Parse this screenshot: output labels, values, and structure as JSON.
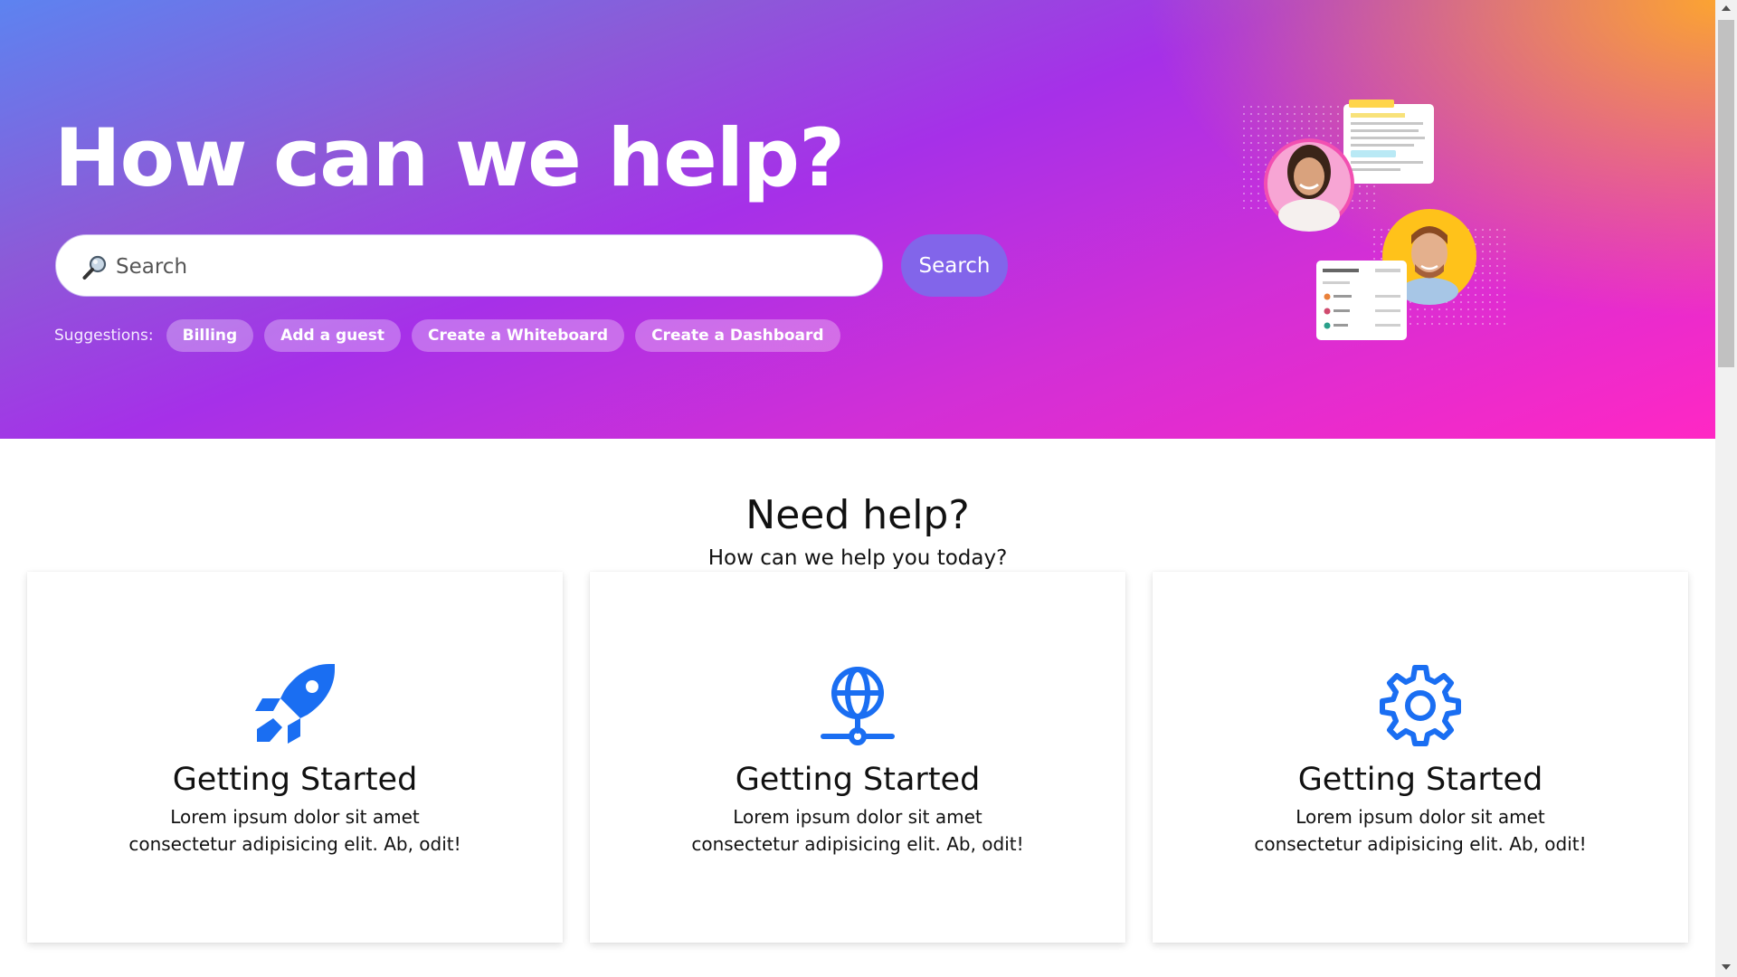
{
  "hero": {
    "title": "How can we help?",
    "search": {
      "placeholder": "Search",
      "button_label": "Search"
    },
    "suggestions": {
      "label": "Suggestions:",
      "items": [
        "Billing",
        "Add a guest",
        "Create a Whiteboard",
        "Create a Dashboard"
      ]
    }
  },
  "help": {
    "title": "Need help?",
    "subtitle": "How can we help you today?",
    "cards": [
      {
        "icon": "rocket-icon",
        "title": "Getting Started",
        "text": "Lorem ipsum dolor sit amet consectetur adipisicing elit. Ab, odit!"
      },
      {
        "icon": "globe-network-icon",
        "title": "Getting Started",
        "text": "Lorem ipsum dolor sit amet consectetur adipisicing elit. Ab, odit!"
      },
      {
        "icon": "gear-icon",
        "title": "Getting Started",
        "text": "Lorem ipsum dolor sit amet consectetur adipisicing elit. Ab, odit!"
      }
    ]
  },
  "colors": {
    "icon_blue": "#1a6ef2",
    "search_button": "#8265ea",
    "hero_gradient": [
      "#5d83f0",
      "#a630e8",
      "#ff27c4",
      "#ffaa28"
    ]
  }
}
